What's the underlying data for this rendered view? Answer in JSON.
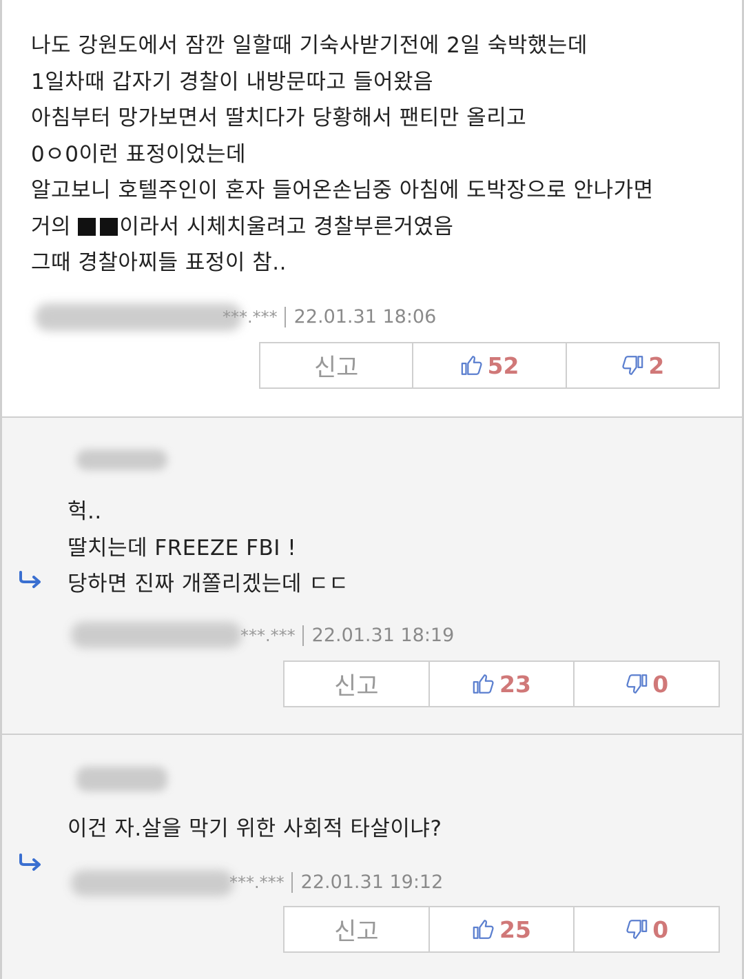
{
  "comments": [
    {
      "lines": [
        "나도 강원도에서 잠깐 일할때 기숙사받기전에 2일 숙박했는데",
        "1일차때 갑자기 경찰이 내방문따고 들어왔음",
        "아침부터 망가보면서 딸치다가 당황해서 팬티만 올리고",
        "0ㅇ0이런 표정이었는데",
        "알고보니 호텔주인이 혼자 들어온손님중 아침에 도박장으로 안나가면",
        "이라서 시체치울려고 경찰부른거였음",
        "그때 경찰아찌들 표정이 참.."
      ],
      "line6_prefix": "거의 ",
      "ip": "***.***",
      "date": "22.01.31 18:06",
      "report": "신고",
      "likes": "52",
      "dislikes": "2"
    },
    {
      "lines": [
        "헉..",
        "딸치는데  FREEZE FBI !",
        "당하면 진짜 개쫄리겠는데 ㄷㄷ"
      ],
      "ip": "***.***",
      "date": "22.01.31 18:19",
      "report": "신고",
      "likes": "23",
      "dislikes": "0"
    },
    {
      "lines": [
        "이건 자.살을 막기 위한 사회적 타살이냐?"
      ],
      "ip": "***.***",
      "date": "22.01.31 19:12",
      "report": "신고",
      "likes": "25",
      "dislikes": "0"
    }
  ],
  "colors": {
    "count": "#d07878",
    "thumb": "#5b7fcf",
    "reply_arrow": "#3a6fd0",
    "border": "#cfcfcf"
  },
  "icons": {
    "like": "thumbs-up-icon",
    "dislike": "thumbs-down-icon",
    "reply": "reply-arrow-icon"
  }
}
